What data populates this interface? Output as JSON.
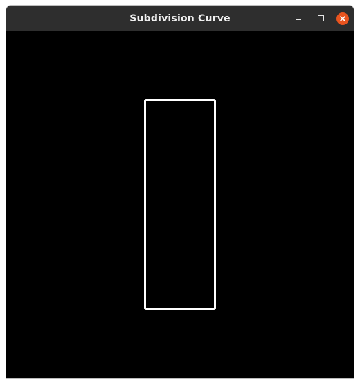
{
  "window": {
    "title": "Subdivision Curve"
  },
  "controls": {
    "minimize_icon": "minimize-icon",
    "maximize_icon": "maximize-icon",
    "close_icon": "close-icon",
    "close_color": "#e9541f"
  },
  "canvas": {
    "background": "#000000",
    "shape": {
      "type": "rectangle-outline",
      "stroke_color": "#ffffff"
    }
  }
}
